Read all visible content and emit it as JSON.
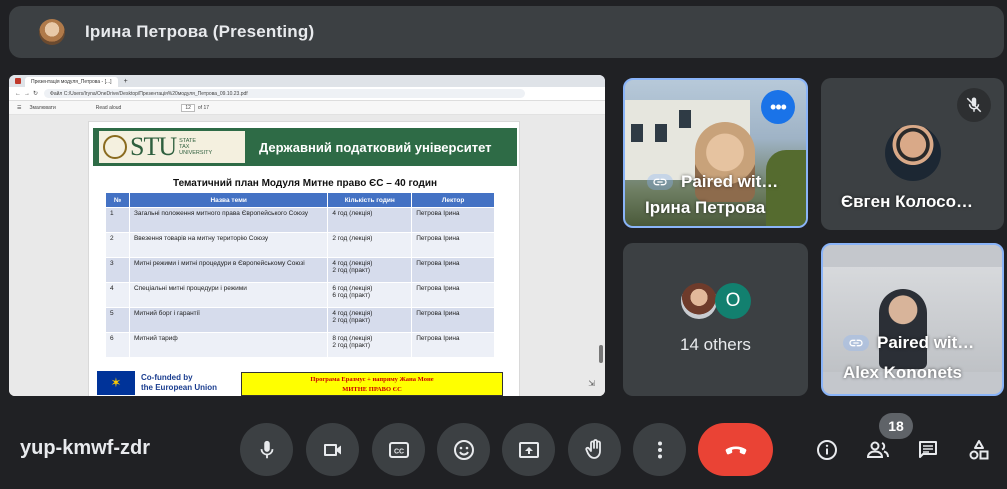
{
  "header": {
    "presenter_title": "Ірина Петрова (Presenting)"
  },
  "shared_screen": {
    "browser_tab": "Презентація модуля_Петрова - [...]",
    "address": "Файл     C:/Users/Iryna/OneDrive/Desktop/Презентація%20модуля_Петрова_09.10.23.pdf",
    "pdf_toolbar": {
      "draw": "Змалювати",
      "read_aloud": "Read aloud",
      "page_input": "12",
      "page_total": "of 17"
    },
    "slide": {
      "logo_text": "STU",
      "logo_sub": [
        "STATE",
        "TAX",
        "UNIVERSITY"
      ],
      "university": "Державний податковий університет",
      "subtitle": "Тематичний план Модуля Митне право ЄС – 40 годин",
      "table": {
        "headers": [
          "№",
          "Назва теми",
          "Кількість годин",
          "Лектор"
        ],
        "rows": [
          [
            "1",
            "Загальні положення митного права Європейського Союзу",
            "4 год (лекція)",
            "Петрова Ірина"
          ],
          [
            "2",
            "Ввезення товарів на митну територію Союзу",
            "2 год (лекція)",
            "Петрова Ірина"
          ],
          [
            "3",
            "Митні режими і митні процедури в Європейському Союзі",
            "4 год (лекція)\n2 год (практ)",
            "Петрова Ірина"
          ],
          [
            "4",
            "Спеціальні митні процедури і режими",
            "6 год (лекція)\n6 год (практ)",
            "Петрова Ірина"
          ],
          [
            "5",
            "Митний борг і гарантії",
            "4 год (лекція)\n2 год (практ)",
            "Петрова Ірина"
          ],
          [
            "6",
            "Митний тариф",
            "8 год (лекція)\n2 год (практ)",
            "Петрова Ірина"
          ]
        ]
      },
      "eu_text_1": "Co-funded by",
      "eu_text_2": "the European Union",
      "erasmus_line1": "Програма Еразмус + напряму Жана Моне",
      "erasmus_line2": "МИТНЕ ПРАВО ЄС"
    }
  },
  "tiles": {
    "irina": {
      "paired": "Paired wit…",
      "name": "Ірина Петрова"
    },
    "evgen": {
      "name": "Євген Колосо…"
    },
    "others": {
      "avatar_letter": "O",
      "count_label": "14 others"
    },
    "alex": {
      "paired": "Paired wit…",
      "name": "Alex Kononets"
    }
  },
  "bottom_bar": {
    "meeting_code": "yup-kmwf-zdr",
    "people_count": "18"
  },
  "colors": {
    "background": "#202124",
    "tile": "#3c4043",
    "active_border": "#8ab4f8",
    "end_call": "#ea4335",
    "slide_header": "#2e6b46",
    "table_header": "#4472c4"
  }
}
